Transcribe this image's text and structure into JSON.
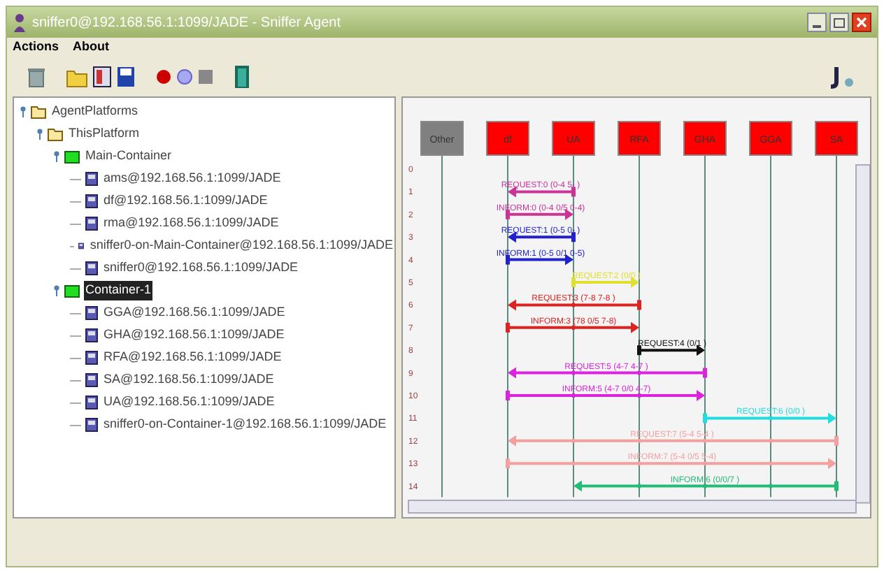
{
  "window": {
    "title": "sniffer0@192.168.56.1:1099/JADE - Sniffer Agent"
  },
  "menu": [
    "Actions",
    "About"
  ],
  "tree": [
    {
      "label": "AgentPlatforms",
      "kind": "folder",
      "selected": false,
      "children": [
        {
          "label": "ThisPlatform",
          "kind": "folder",
          "selected": false,
          "children": [
            {
              "label": "Main-Container",
              "kind": "container",
              "selected": false,
              "children": [
                {
                  "label": "ams@192.168.56.1:1099/JADE",
                  "kind": "agent",
                  "selected": false
                },
                {
                  "label": "df@192.168.56.1:1099/JADE",
                  "kind": "agent",
                  "selected": false
                },
                {
                  "label": "rma@192.168.56.1:1099/JADE",
                  "kind": "agent",
                  "selected": false
                },
                {
                  "label": "sniffer0-on-Main-Container@192.168.56.1:1099/JADE",
                  "kind": "agent",
                  "selected": false
                },
                {
                  "label": "sniffer0@192.168.56.1:1099/JADE",
                  "kind": "agent",
                  "selected": false
                }
              ]
            },
            {
              "label": "Container-1",
              "kind": "container",
              "selected": true,
              "children": [
                {
                  "label": "GGA@192.168.56.1:1099/JADE",
                  "kind": "agent",
                  "selected": false
                },
                {
                  "label": "GHA@192.168.56.1:1099/JADE",
                  "kind": "agent",
                  "selected": false
                },
                {
                  "label": "RFA@192.168.56.1:1099/JADE",
                  "kind": "agent",
                  "selected": false
                },
                {
                  "label": "SA@192.168.56.1:1099/JADE",
                  "kind": "agent",
                  "selected": false
                },
                {
                  "label": "UA@192.168.56.1:1099/JADE",
                  "kind": "agent",
                  "selected": false
                },
                {
                  "label": "sniffer0-on-Container-1@192.168.56.1:1099/JADE",
                  "kind": "agent",
                  "selected": false
                }
              ]
            }
          ]
        }
      ]
    }
  ],
  "diagram": {
    "agents": [
      {
        "name": "Other",
        "color": "#808080"
      },
      {
        "name": "df",
        "color": "#ff0000"
      },
      {
        "name": "UA",
        "color": "#ff0000"
      },
      {
        "name": "RFA",
        "color": "#ff0000"
      },
      {
        "name": "GHA",
        "color": "#ff0000"
      },
      {
        "name": "GGA",
        "color": "#ff0000"
      },
      {
        "name": "SA",
        "color": "#ff0000"
      }
    ],
    "row_numbers": [
      "0",
      "1",
      "2",
      "3",
      "4",
      "5",
      "6",
      "7",
      "8",
      "9",
      "10",
      "11",
      "12",
      "13",
      "14"
    ],
    "messages": [
      {
        "label": "REQUEST:0 (0-4 5-  )",
        "color": "#cc3399",
        "cells": [
          {
            "kind": "none"
          },
          {
            "kind": "head"
          },
          {
            "kind": "tail"
          },
          {
            "kind": "none"
          },
          {
            "kind": "none"
          },
          {
            "kind": "none"
          },
          {
            "kind": "none"
          }
        ]
      },
      {
        "label": "INFORM:0 (0-4 0/5 0-4)",
        "color": "#cc3399",
        "cells": [
          {
            "kind": "none"
          },
          {
            "kind": "tail"
          },
          {
            "kind": "head"
          },
          {
            "kind": "none"
          },
          {
            "kind": "none"
          },
          {
            "kind": "none"
          },
          {
            "kind": "none"
          }
        ]
      },
      {
        "label": "REQUEST:1 (0-5 0-  )",
        "color": "#2222cc",
        "cells": [
          {
            "kind": "none"
          },
          {
            "kind": "head"
          },
          {
            "kind": "tail"
          },
          {
            "kind": "none"
          },
          {
            "kind": "none"
          },
          {
            "kind": "none"
          },
          {
            "kind": "none"
          }
        ]
      },
      {
        "label": "INFORM:1 (0-5 0/1 0-5)",
        "color": "#2222cc",
        "cells": [
          {
            "kind": "none"
          },
          {
            "kind": "tail"
          },
          {
            "kind": "head"
          },
          {
            "kind": "none"
          },
          {
            "kind": "none"
          },
          {
            "kind": "none"
          },
          {
            "kind": "none"
          }
        ]
      },
      {
        "label": "REQUEST:2 (0/0  )",
        "color": "#e0e030",
        "cells": [
          {
            "kind": "none"
          },
          {
            "kind": "none"
          },
          {
            "kind": "tail"
          },
          {
            "kind": "head"
          },
          {
            "kind": "none"
          },
          {
            "kind": "none"
          },
          {
            "kind": "none"
          }
        ]
      },
      {
        "label": "REQUEST:3 (7-8 7-8  )",
        "color": "#dd2222",
        "cells": [
          {
            "kind": "none"
          },
          {
            "kind": "head"
          },
          {
            "kind": "through"
          },
          {
            "kind": "tail"
          },
          {
            "kind": "none"
          },
          {
            "kind": "none"
          },
          {
            "kind": "none"
          }
        ]
      },
      {
        "label": "INFORM:3 (78 0/5 7-8)",
        "color": "#dd2222",
        "cells": [
          {
            "kind": "none"
          },
          {
            "kind": "tail"
          },
          {
            "kind": "through"
          },
          {
            "kind": "head"
          },
          {
            "kind": "none"
          },
          {
            "kind": "none"
          },
          {
            "kind": "none"
          }
        ]
      },
      {
        "label": "REQUEST:4 (0/1  )",
        "color": "#111111",
        "cells": [
          {
            "kind": "none"
          },
          {
            "kind": "none"
          },
          {
            "kind": "none"
          },
          {
            "kind": "tail"
          },
          {
            "kind": "head"
          },
          {
            "kind": "none"
          },
          {
            "kind": "none"
          }
        ]
      },
      {
        "label": "REQUEST:5 (4-7 4-7  )",
        "color": "#dd22dd",
        "cells": [
          {
            "kind": "none"
          },
          {
            "kind": "head"
          },
          {
            "kind": "through"
          },
          {
            "kind": "through"
          },
          {
            "kind": "tail"
          },
          {
            "kind": "none"
          },
          {
            "kind": "none"
          }
        ]
      },
      {
        "label": "INFORM:5 (4-7 0/0 4-7)",
        "color": "#dd22dd",
        "cells": [
          {
            "kind": "none"
          },
          {
            "kind": "tail"
          },
          {
            "kind": "through"
          },
          {
            "kind": "through"
          },
          {
            "kind": "head"
          },
          {
            "kind": "none"
          },
          {
            "kind": "none"
          }
        ]
      },
      {
        "label": "REQUEST:6 (0/0  )",
        "color": "#22dddd",
        "cells": [
          {
            "kind": "none"
          },
          {
            "kind": "none"
          },
          {
            "kind": "none"
          },
          {
            "kind": "none"
          },
          {
            "kind": "tail"
          },
          {
            "kind": "through"
          },
          {
            "kind": "head"
          }
        ]
      },
      {
        "label": "REQUEST:7 (5-4 5-4  )",
        "color": "#f4a0a0",
        "cells": [
          {
            "kind": "none"
          },
          {
            "kind": "head"
          },
          {
            "kind": "through"
          },
          {
            "kind": "through"
          },
          {
            "kind": "through"
          },
          {
            "kind": "through"
          },
          {
            "kind": "tail"
          }
        ]
      },
      {
        "label": "INFORM:7 (5-4 0/5 5-4)",
        "color": "#f4a0a0",
        "cells": [
          {
            "kind": "none"
          },
          {
            "kind": "tail"
          },
          {
            "kind": "through"
          },
          {
            "kind": "through"
          },
          {
            "kind": "through"
          },
          {
            "kind": "through"
          },
          {
            "kind": "head"
          }
        ]
      },
      {
        "label": "INFORM:6 (0/0/7  )",
        "color": "#22bb77",
        "cells": [
          {
            "kind": "none"
          },
          {
            "kind": "none"
          },
          {
            "kind": "head"
          },
          {
            "kind": "through"
          },
          {
            "kind": "through"
          },
          {
            "kind": "through"
          },
          {
            "kind": "tail"
          }
        ]
      }
    ]
  }
}
